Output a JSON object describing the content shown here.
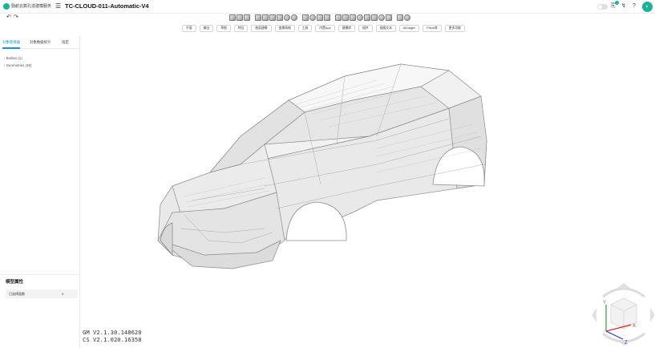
{
  "app": {
    "name": "励航云数孔造建模服务",
    "document_title": "TC-CLOUD-011-Automatic-V4"
  },
  "menu": {
    "items": [
      "平面",
      "输出",
      "草图",
      "特征",
      "曲面建模",
      "变换网格",
      "工具",
      "内置App",
      "建模库",
      "插件",
      "插图文本",
      "AiCaigen",
      "Prism库",
      "更多功能"
    ]
  },
  "sidebar": {
    "tabs": [
      "对象管理器",
      "对象数据统计",
      "指定"
    ],
    "tree": [
      {
        "label": "Bodies (1)"
      },
      {
        "label": "Geometries (38)"
      }
    ]
  },
  "properties": {
    "title": "模型属性",
    "rows": [
      {
        "key": "已选择面数",
        "value": "0"
      }
    ]
  },
  "versions": {
    "gm": "GM V2.1.30.148620",
    "cs": "CS V2.1.020.16358"
  },
  "nav_cube": {
    "axis_x": "X",
    "axis_y": "Y",
    "axis_z": "Z"
  },
  "icons": {
    "logo": "cloud-logo-icon",
    "menu": "menu-icon",
    "undo": "undo-icon",
    "redo": "redo-icon",
    "help": "help-icon",
    "settings": "settings-icon"
  },
  "colors": {
    "accent": "#1c8fe0",
    "brand": "#19b39a"
  }
}
